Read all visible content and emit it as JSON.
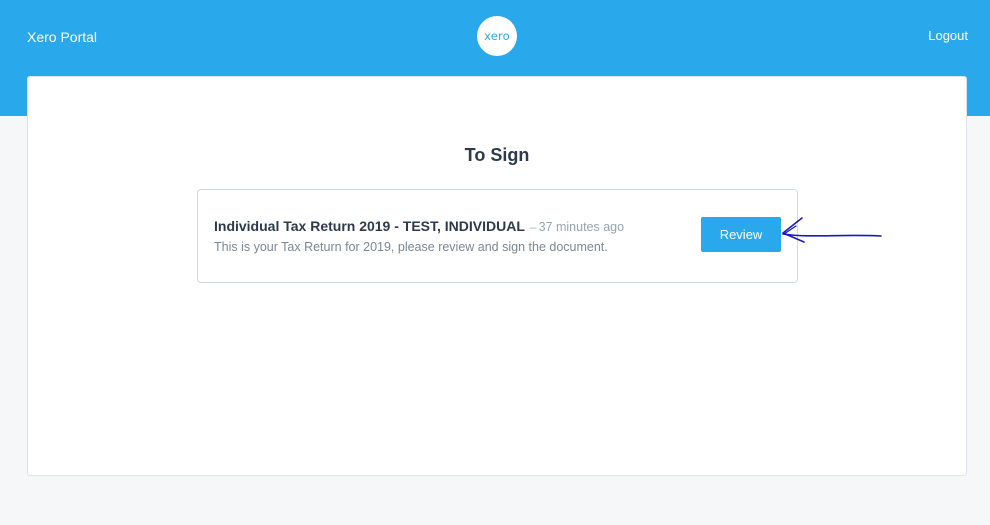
{
  "header": {
    "app_title": "Xero Portal",
    "logo_text": "xero",
    "logout_label": "Logout",
    "bar_color": "#2aa8ec"
  },
  "main": {
    "page_title": "To Sign",
    "documents": [
      {
        "title": "Individual Tax Return 2019 - TEST, INDIVIDUAL",
        "separator": "–",
        "time_ago": "37 minutes ago",
        "description": "This is your Tax Return for 2019, please review and sign the document.",
        "action_label": "Review"
      }
    ]
  },
  "annotation": {
    "type": "hand-drawn arrow pointing at review button",
    "color": "#1a1ab8"
  }
}
